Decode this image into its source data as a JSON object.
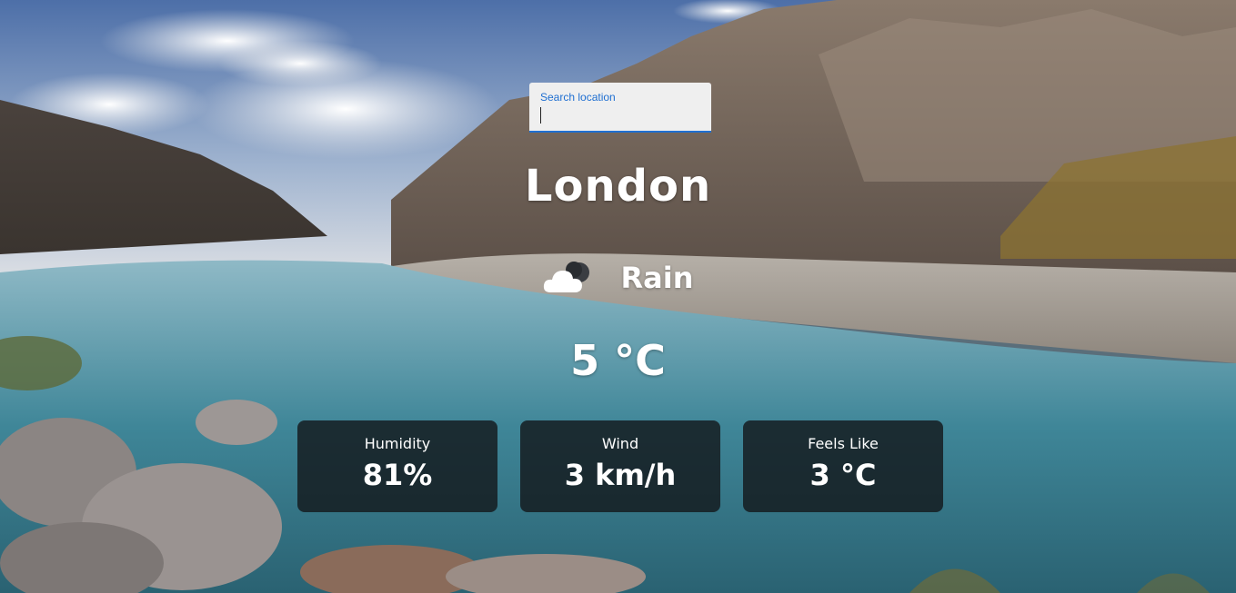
{
  "search": {
    "label": "Search location",
    "value": ""
  },
  "weather": {
    "city": "London",
    "condition": "Rain",
    "condition_icon": "cloud-rain-night-icon",
    "temperature": "5 °C"
  },
  "stats": [
    {
      "label": "Humidity",
      "value": "81%"
    },
    {
      "label": "Wind",
      "value": "3 km/h"
    },
    {
      "label": "Feels Like",
      "value": "3 °C"
    }
  ],
  "colors": {
    "accent": "#1f6fd1",
    "card_bg": "#14181c",
    "text": "#ffffff"
  }
}
